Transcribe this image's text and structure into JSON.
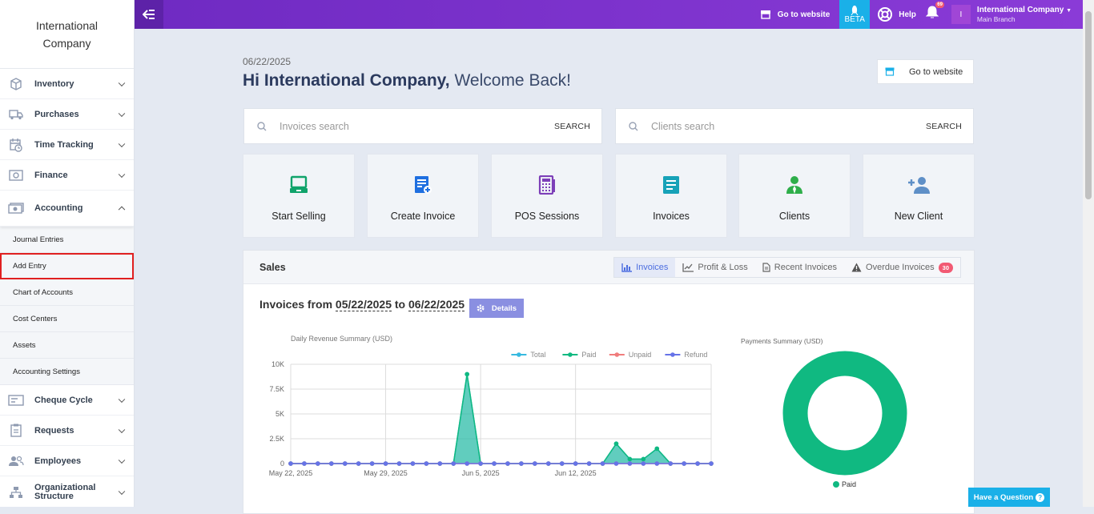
{
  "sidebar": {
    "brand": "International Company",
    "items": [
      {
        "label": "Inventory",
        "icon": "box-icon"
      },
      {
        "label": "Purchases",
        "icon": "truck-icon"
      },
      {
        "label": "Time Tracking",
        "icon": "calendar-clock-icon"
      },
      {
        "label": "Finance",
        "icon": "safe-icon"
      },
      {
        "label": "Accounting",
        "icon": "money-icon"
      }
    ],
    "accounting_sub": [
      "Journal Entries",
      "Add Entry",
      "Chart of Accounts",
      "Cost Centers",
      "Assets",
      "Accounting Settings"
    ],
    "items_after": [
      {
        "label": "Cheque Cycle",
        "icon": "cheque-icon"
      },
      {
        "label": "Requests",
        "icon": "clipboard-icon"
      },
      {
        "label": "Employees",
        "icon": "users-icon"
      },
      {
        "label": "Organizational Structure",
        "icon": "org-chart-icon"
      }
    ]
  },
  "topbar": {
    "goto_website": "Go to website",
    "beta": "BETA",
    "help": "Help",
    "notifications": "69",
    "avatar_letter": "I",
    "account_name": "International Company",
    "branch": "Main Branch"
  },
  "header": {
    "date": "06/22/2025",
    "greeting": "Hi International Company,",
    "welcome": " Welcome Back!",
    "goto_website": "Go to website"
  },
  "search": {
    "invoices_placeholder": "Invoices search",
    "clients_placeholder": "Clients search",
    "button": "SEARCH"
  },
  "tiles": [
    {
      "label": "Start Selling",
      "color": "#10a36b"
    },
    {
      "label": "Create Invoice",
      "color": "#1f6fe0"
    },
    {
      "label": "POS Sessions",
      "color": "#7d3fb8"
    },
    {
      "label": "Invoices",
      "color": "#17a2b8"
    },
    {
      "label": "Clients",
      "color": "#2eae4a"
    },
    {
      "label": "New Client",
      "color": "#5e8fc7"
    }
  ],
  "sales": {
    "title": "Sales",
    "tabs": [
      "Invoices",
      "Profit & Loss",
      "Recent Invoices",
      "Overdue Invoices"
    ],
    "overdue_count": "30",
    "invoices_from": "Invoices from",
    "date_from": "05/22/2025",
    "to": "to",
    "date_to": "06/22/2025",
    "details": "Details"
  },
  "chart_data": [
    {
      "type": "area",
      "title": "Daily Revenue Summary (USD)",
      "legend_position": "top-right",
      "y_ticks": [
        "0",
        "2.5K",
        "5K",
        "7.5K",
        "10K"
      ],
      "ylim": [
        0,
        10000
      ],
      "x_ticks": [
        "May 22, 2025",
        "May 29, 2025",
        "Jun 5, 2025",
        "Jun 12, 2025"
      ],
      "x": [
        "2025-05-22",
        "2025-05-23",
        "2025-05-24",
        "2025-05-25",
        "2025-05-26",
        "2025-05-27",
        "2025-05-28",
        "2025-05-29",
        "2025-05-30",
        "2025-05-31",
        "2025-06-01",
        "2025-06-02",
        "2025-06-03",
        "2025-06-04",
        "2025-06-05",
        "2025-06-06",
        "2025-06-07",
        "2025-06-08",
        "2025-06-09",
        "2025-06-10",
        "2025-06-11",
        "2025-06-12",
        "2025-06-13",
        "2025-06-14",
        "2025-06-15",
        "2025-06-16",
        "2025-06-17",
        "2025-06-18",
        "2025-06-19",
        "2025-06-20",
        "2025-06-21",
        "2025-06-22"
      ],
      "series": [
        {
          "name": "Total",
          "color": "#36b9e0",
          "values": [
            0,
            0,
            0,
            0,
            0,
            0,
            0,
            0,
            0,
            0,
            0,
            0,
            0,
            9000,
            0,
            0,
            0,
            0,
            0,
            0,
            0,
            0,
            0,
            0,
            2000,
            450,
            450,
            1500,
            0,
            0,
            0,
            0
          ]
        },
        {
          "name": "Paid",
          "color": "#10b981",
          "values": [
            0,
            0,
            0,
            0,
            0,
            0,
            0,
            0,
            0,
            0,
            0,
            0,
            0,
            9000,
            0,
            0,
            0,
            0,
            0,
            0,
            0,
            0,
            0,
            0,
            2000,
            450,
            450,
            1500,
            0,
            0,
            0,
            0
          ]
        },
        {
          "name": "Unpaid",
          "color": "#f07c7c",
          "values": [
            0,
            0,
            0,
            0,
            0,
            0,
            0,
            0,
            0,
            0,
            0,
            0,
            0,
            0,
            0,
            0,
            0,
            0,
            0,
            0,
            0,
            0,
            0,
            0,
            0,
            0,
            0,
            0,
            0,
            0,
            0,
            0
          ]
        },
        {
          "name": "Refund",
          "color": "#6673e8",
          "values": [
            0,
            0,
            0,
            0,
            0,
            0,
            0,
            0,
            0,
            0,
            0,
            0,
            0,
            0,
            0,
            0,
            0,
            0,
            0,
            0,
            0,
            0,
            0,
            0,
            0,
            0,
            0,
            0,
            0,
            0,
            0,
            0
          ]
        }
      ]
    },
    {
      "type": "pie",
      "title": "Payments Summary (USD)",
      "categories": [
        "Paid"
      ],
      "values": [
        100
      ],
      "colors": [
        "#10b981"
      ]
    }
  ],
  "help_widget": "Have a Question"
}
